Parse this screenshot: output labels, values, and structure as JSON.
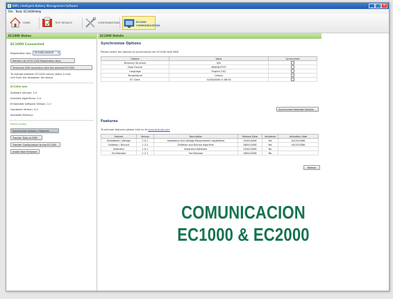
{
  "window": {
    "title": "BMS, Intelligent Battery Management Software",
    "controls": [
      "_",
      "□",
      "✕"
    ]
  },
  "menu": [
    "File",
    "Tools",
    "EC1000",
    "Help"
  ],
  "toolbar": {
    "items": [
      {
        "label": "HOME",
        "icon": "home-icon"
      },
      {
        "label": "TEST RESULTS",
        "icon": "test-results-icon"
      },
      {
        "label": "CONFIGURATIONS",
        "icon": "tools-icon"
      },
      {
        "label": "EC1000 COMMUNICATION",
        "icon": "communication-icon",
        "active": true
      }
    ]
  },
  "left": {
    "header": "EC1000 Status",
    "status": "EC1000 Connected",
    "registration_label": "Registration Key:",
    "registration_value": "EC1000-040010",
    "btn_refresh_reg": "Refresh List Of EC1000 Registration Keys",
    "btn_terminate": "Terminate USB connection with the selected EC1000",
    "help_text": [
      "To change between EC1000 simply select a new",
      "unit from the dropdown list above."
    ],
    "info_title": "EC1000 Info",
    "info": [
      "Software Version: 2.0",
      "Installed Algorithms: 3.0",
      "Embedded Software Version: 2.2",
      "Hardware Version: 4.0",
      "Available Memory:"
    ],
    "actions_title": "Select Action",
    "actions": [
      {
        "label": "Synchronize Options / Features",
        "selected": true
      },
      {
        "label": "Transfer Data to BMS",
        "selected": false
      },
      {
        "label": "Transfer Configuration to the EC1000",
        "selected": false
      },
      {
        "label": "Install New Firmware",
        "selected": false
      }
    ]
  },
  "right": {
    "header": "EC1000 Details",
    "sync_title": "Synchronize Options",
    "sync_desc": "Please select the options to synchronize the EC1000 with BMS",
    "sync_columns": [
      "Options",
      "Value",
      "Synchronize"
    ],
    "sync_rows": [
      {
        "option": "Directory Structure",
        "value": "N/A"
      },
      {
        "option": "Date Format",
        "value": "MM/DD/YYYY"
      },
      {
        "option": "Language",
        "value": "English (US)"
      },
      {
        "option": "Temperature",
        "value": "Celsius"
      },
      {
        "option": "EC Clock",
        "value": "10/30/2006 11:08:30"
      }
    ],
    "sync_button": "Synchronize Selected Options",
    "features_title": "Features",
    "features_desc": "To activate features please visit us at",
    "features_link": "www.dcdude.com",
    "features_columns": [
      "Feature",
      "Version",
      "Description",
      "Release Date",
      "Activated",
      "Activation Date"
    ],
    "features_rows": [
      [
        "Broadband / Voltage",
        "1.0.1",
        "Impedance And Voltage Measurement capabilities",
        "05/01/2006",
        "Yes",
        "04/15/2006"
      ],
      [
        "Sulfation / Discout",
        "1.2.3",
        "Sulfation and Discout algorithm",
        "06/01/2006",
        "Yes",
        "04/15/2006"
      ],
      [
        "Voltmeter",
        "1.0.1",
        "Advanced Voltmeter",
        "05/01/2006",
        "No",
        ""
      ],
      [
        "Oscilloscope",
        "1.2.1",
        "Oscilloscope",
        "06/01/2006",
        "No",
        ""
      ]
    ],
    "refresh_button": "Refresh"
  },
  "overlay": {
    "line1": "COMUNICACION",
    "line2": "EC1000 & EC2000"
  },
  "colors": {
    "overlay_text": "#15734e",
    "panel_header": "#9fcf74",
    "title_bar": "#1e5ab0"
  }
}
